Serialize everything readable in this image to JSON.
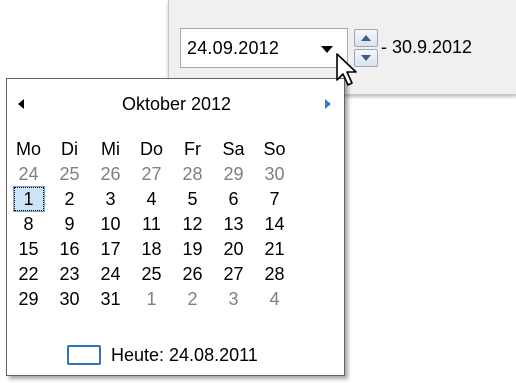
{
  "date_picker": {
    "start_value": "24.09.2012",
    "end_label": "- 30.9.2012"
  },
  "calendar": {
    "month_year": "Oktober 2012",
    "day_headers": [
      "Mo",
      "Di",
      "Mi",
      "Do",
      "Fr",
      "Sa",
      "So"
    ],
    "weeks": [
      [
        "24",
        "25",
        "26",
        "27",
        "28",
        "29",
        "30"
      ],
      [
        "1",
        "2",
        "3",
        "4",
        "5",
        "6",
        "7"
      ],
      [
        "8",
        "9",
        "10",
        "11",
        "12",
        "13",
        "14"
      ],
      [
        "15",
        "16",
        "17",
        "18",
        "19",
        "20",
        "21"
      ],
      [
        "22",
        "23",
        "24",
        "25",
        "26",
        "27",
        "28"
      ],
      [
        "29",
        "30",
        "31",
        "1",
        "2",
        "3",
        "4"
      ]
    ],
    "selected_day": "1",
    "today_label": "Heute: 24.08.2011"
  },
  "colors": {
    "accent": "#2d72c2",
    "nav_next": "#3a78d8",
    "muted_day": "#808080",
    "selection": "#cde3f7"
  },
  "icons": [
    "dropdown-arrow-icon",
    "spin-up-icon",
    "spin-down-icon",
    "prev-month-icon",
    "next-month-icon",
    "mouse-cursor-icon"
  ]
}
